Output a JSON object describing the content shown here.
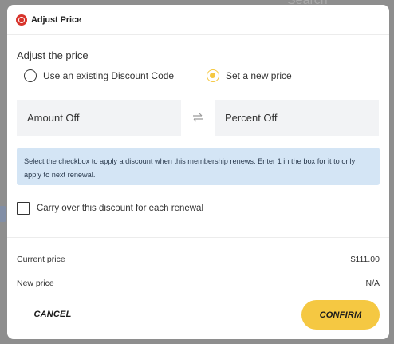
{
  "backdrop": {
    "search_text": "Search"
  },
  "dialog": {
    "title": "Adjust Price",
    "section_label": "Adjust the price",
    "options": [
      {
        "label": "Use an existing Discount Code",
        "selected": false
      },
      {
        "label": "Set a new price",
        "selected": true
      }
    ],
    "amount_off_placeholder": "Amount Off",
    "percent_off_placeholder": "Percent Off",
    "info_text": "Select the checkbox to apply a discount when this membership renews. Enter 1 in the box for it to only apply to next renewal.",
    "carry_over_label": "Carry over this discount for each renewal",
    "carry_over_checked": false,
    "current_price_label": "Current price",
    "current_price_value": "$111.00",
    "new_price_label": "New price",
    "new_price_value": "N/A",
    "cancel_label": "CANCEL",
    "confirm_label": "CONFIRM"
  },
  "colors": {
    "accent": "#f5c842",
    "info_bg": "#d4e5f5",
    "brand_red": "#d8342c"
  }
}
